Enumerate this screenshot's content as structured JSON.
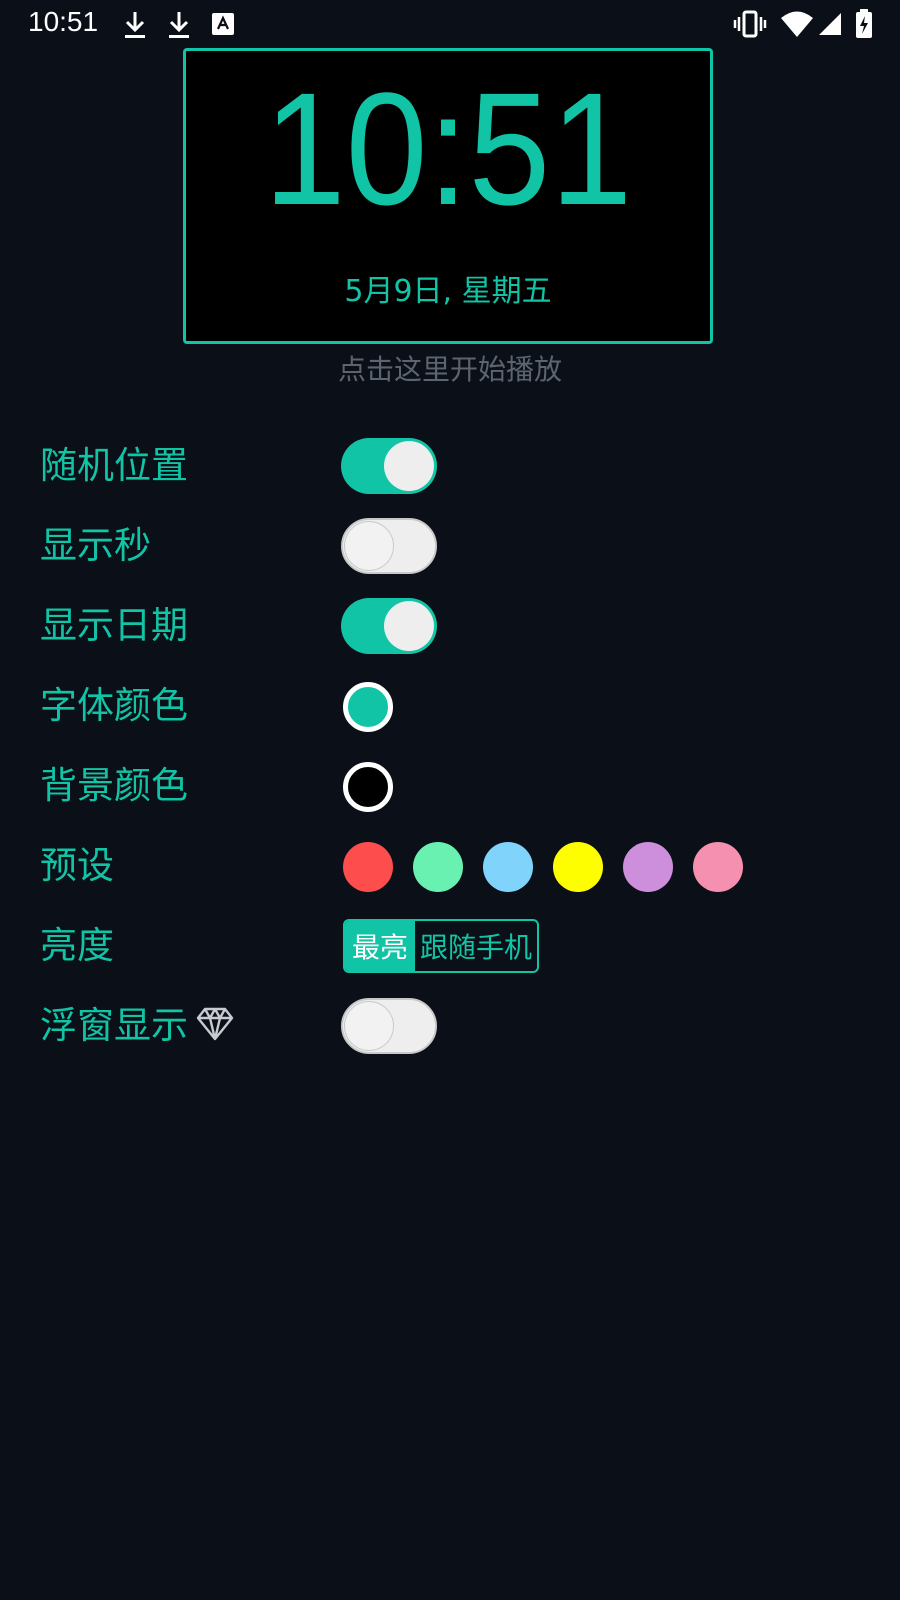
{
  "status_bar": {
    "time": "10:51",
    "icons": [
      "download-icon",
      "download-icon",
      "text-box-icon",
      "vibrate-icon",
      "wifi-icon",
      "signal-icon",
      "battery-charging-icon"
    ]
  },
  "clock": {
    "time": "10:51",
    "date": "5月9日, 星期五",
    "color": "#11c4a6",
    "background": "#000000"
  },
  "hint": "点击这里开始播放",
  "settings": {
    "random_position": {
      "label": "随机位置",
      "on": true
    },
    "show_seconds": {
      "label": "显示秒",
      "on": false
    },
    "show_date": {
      "label": "显示日期",
      "on": true
    },
    "font_color": {
      "label": "字体颜色",
      "color": "#11c4a6"
    },
    "background_color": {
      "label": "背景颜色",
      "color": "#000000"
    },
    "presets": {
      "label": "预设",
      "colors": [
        "#fe4d4d",
        "#68f1b1",
        "#80d4fc",
        "#fffe00",
        "#cd8fdc",
        "#f590b0"
      ]
    },
    "brightness": {
      "label": "亮度",
      "options": [
        "最亮",
        "跟随手机"
      ],
      "selected": "最亮"
    },
    "floating_window": {
      "label": "浮窗显示",
      "icon": "diamond-icon",
      "on": false
    }
  },
  "theme": {
    "accent": "#11c4a6",
    "page_bg": "#0b0f17"
  }
}
